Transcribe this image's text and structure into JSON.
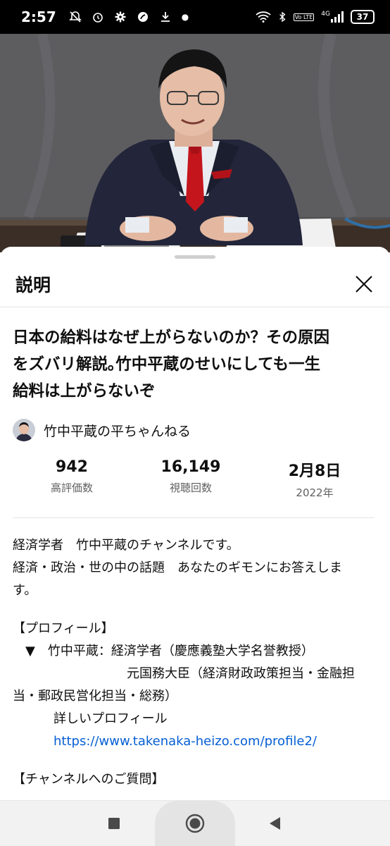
{
  "status_bar": {
    "time": "2:57",
    "network": "4G",
    "volte": "Vo LTE",
    "battery": "37"
  },
  "sheet": {
    "title": "説明",
    "close_icon": "close-icon"
  },
  "video": {
    "title": "日本の給料はなぜ上がらないのか？その原因をズバリ解説｡竹中平蔵のせいにしても一生給料は上がらないぞ",
    "title_lines": [
      "日本の給料はなぜ上がらないのか？その原因",
      "をズバリ解説｡竹中平蔵のせいにしても一生",
      "給料は上がらないぞ"
    ],
    "channel_name": "竹中平蔵の平ちゃんねる"
  },
  "stats": {
    "likes_value": "942",
    "likes_label": "高評価数",
    "views_value": "16,149",
    "views_label": "視聴回数",
    "date_value": "2月8日",
    "date_label": "2022年"
  },
  "description": {
    "line1": "経済学者　竹中平蔵のチャンネルです。",
    "line2": "経済・政治・世の中の話題　あなたのギモンにお答えしま",
    "line3": "す。",
    "profile_heading": "【プロフィール】",
    "profile_line1": "▼　竹中平蔵：経済学者（慶應義塾大学名誉教授）",
    "profile_line2": "元国務大臣（経済財政政策担当・金融担",
    "profile_line3": "当・郵政民営化担当・総務）",
    "profile_line4": "詳しいプロフィール",
    "profile_link": "https://www.takenaka-heizo.com/profile2/",
    "questions_heading": "【チャンネルへのご質問】"
  },
  "colors": {
    "link": "#065fd4",
    "secondary_text": "#606060",
    "tie": "#c4151c"
  }
}
